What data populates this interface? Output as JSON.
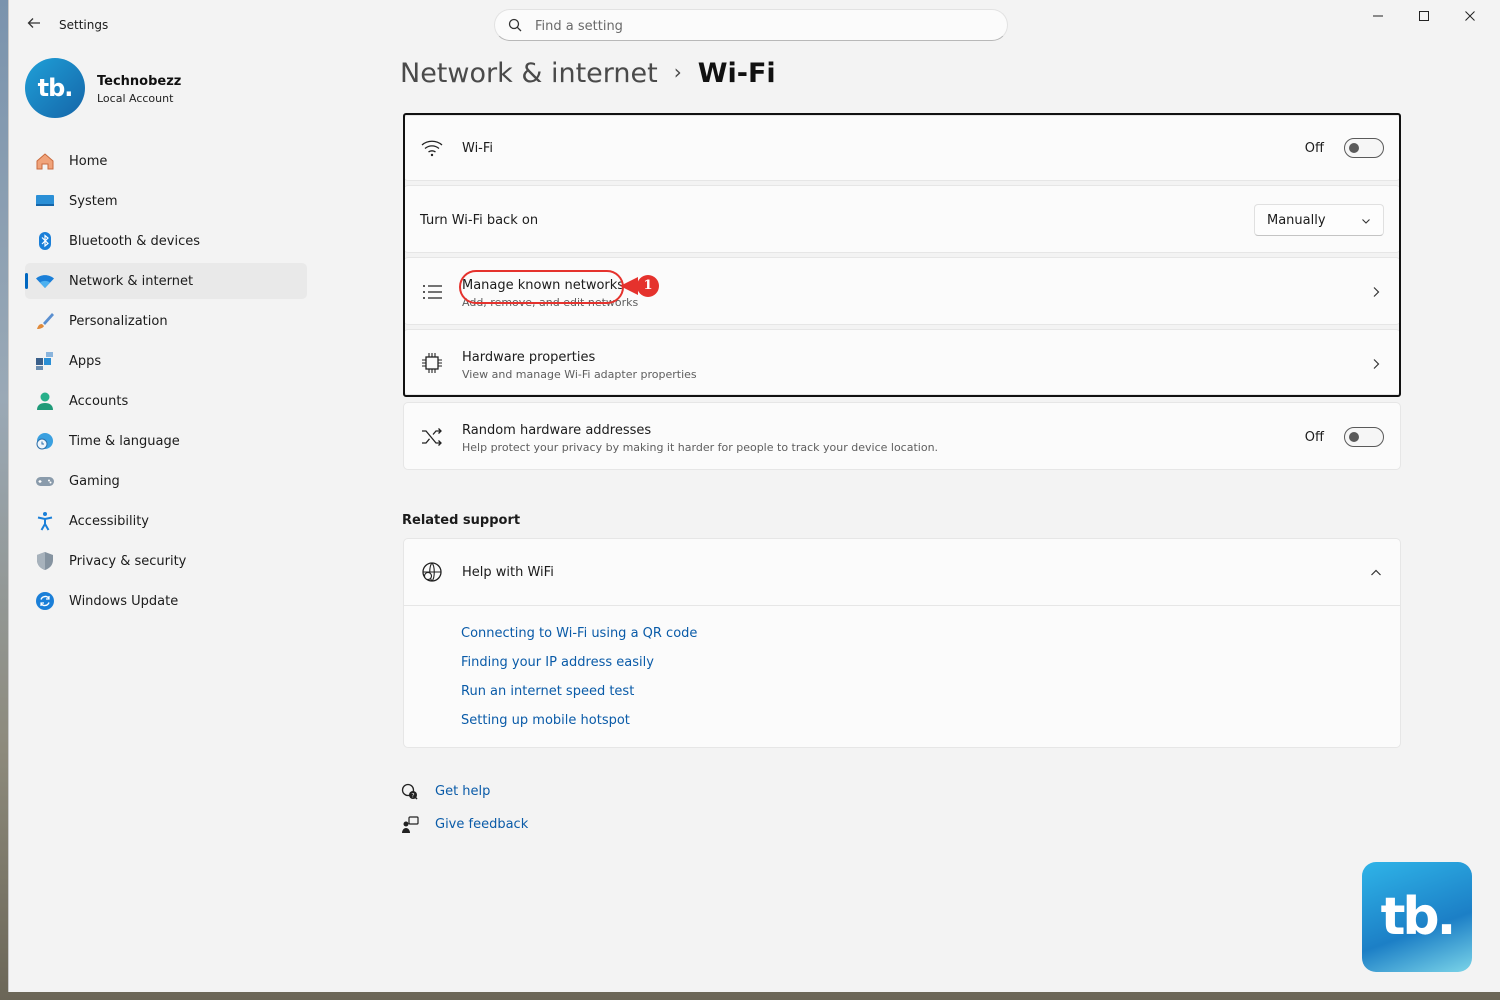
{
  "window": {
    "title": "Settings"
  },
  "search": {
    "placeholder": "Find a setting"
  },
  "window_controls": {
    "minimize": "—",
    "maximize": "☐",
    "close": "✕"
  },
  "profile": {
    "avatar_text": "tb.",
    "name": "Technobezz",
    "account_type": "Local Account"
  },
  "sidebar": {
    "items": [
      {
        "label": "Home",
        "icon": "home-icon"
      },
      {
        "label": "System",
        "icon": "system-icon"
      },
      {
        "label": "Bluetooth & devices",
        "icon": "bluetooth-icon"
      },
      {
        "label": "Network & internet",
        "icon": "wifi-icon",
        "active": true
      },
      {
        "label": "Personalization",
        "icon": "brush-icon"
      },
      {
        "label": "Apps",
        "icon": "apps-icon"
      },
      {
        "label": "Accounts",
        "icon": "account-icon"
      },
      {
        "label": "Time & language",
        "icon": "globe-clock-icon"
      },
      {
        "label": "Gaming",
        "icon": "gamepad-icon"
      },
      {
        "label": "Accessibility",
        "icon": "accessibility-icon"
      },
      {
        "label": "Privacy & security",
        "icon": "shield-icon"
      },
      {
        "label": "Windows Update",
        "icon": "update-icon"
      }
    ]
  },
  "breadcrumb": {
    "parent": "Network & internet",
    "separator": "›",
    "current": "Wi-Fi"
  },
  "settings": {
    "wifi": {
      "title": "Wi-Fi",
      "state": "Off"
    },
    "turn_back_on": {
      "title": "Turn Wi-Fi back on",
      "value": "Manually"
    },
    "manage_networks": {
      "title": "Manage known networks",
      "subtitle": "Add, remove, and edit networks"
    },
    "hardware": {
      "title": "Hardware properties",
      "subtitle": "View and manage Wi-Fi adapter properties"
    },
    "random_hw": {
      "title": "Random hardware addresses",
      "subtitle": "Help protect your privacy by making it harder for people to track your device location.",
      "state": "Off"
    }
  },
  "annotation": {
    "number": "1",
    "color": "#e5322d"
  },
  "related": {
    "title": "Related support",
    "help_title": "Help with WiFi",
    "links": [
      "Connecting to Wi-Fi using a QR code",
      "Finding your IP address easily",
      "Run an internet speed test",
      "Setting up mobile hotspot"
    ]
  },
  "footer": {
    "get_help": "Get help",
    "give_feedback": "Give feedback"
  },
  "brand_logo": {
    "text": "tb."
  },
  "colors": {
    "accent": "#0067c0",
    "link": "#0a5ba8",
    "annotation": "#e5322d"
  }
}
